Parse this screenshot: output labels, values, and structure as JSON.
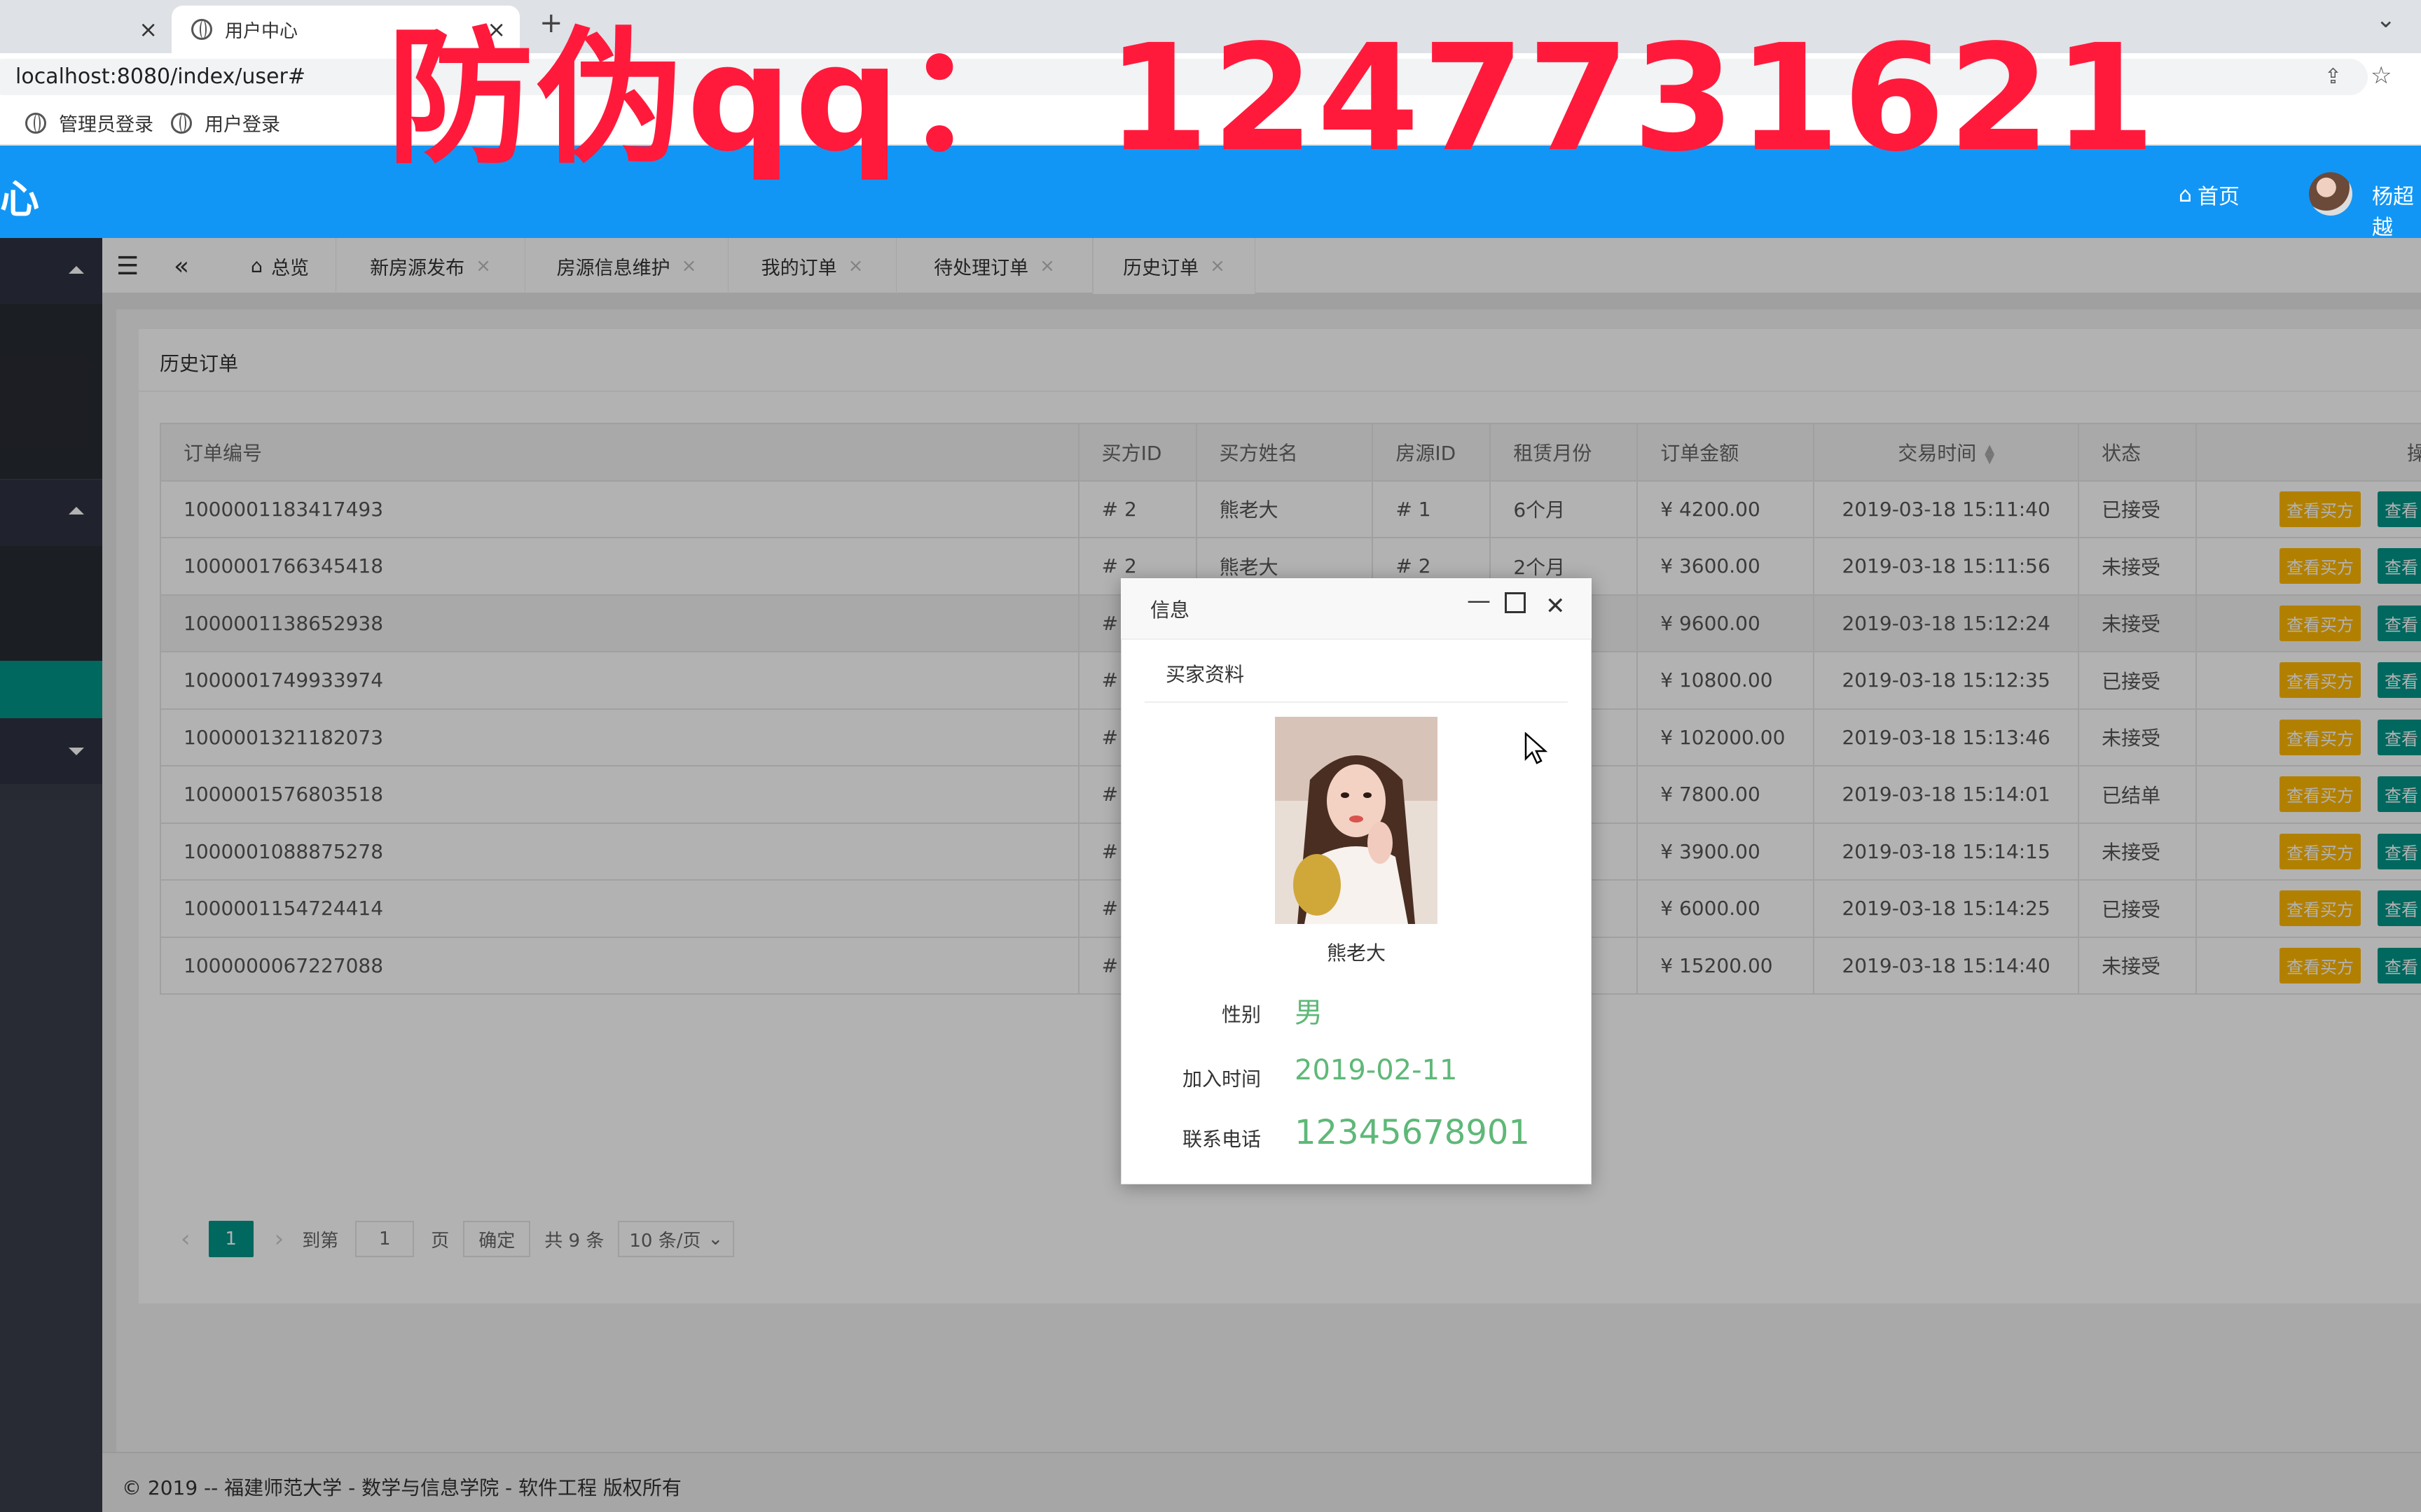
{
  "browser": {
    "tabs": [
      {
        "label": ""
      },
      {
        "label": "用户中心"
      }
    ],
    "url": "localhost:8080/index/user#",
    "bookmarks": [
      "管理员登录",
      "用户登录"
    ]
  },
  "watermark": "防伪qq： 1247731621",
  "header": {
    "logo_fragment": "心",
    "home_label": "首页",
    "user_name": "杨超越"
  },
  "tabs": [
    {
      "label": "总览"
    },
    {
      "label": "新房源发布"
    },
    {
      "label": "房源信息维护"
    },
    {
      "label": "我的订单"
    },
    {
      "label": "待处理订单"
    },
    {
      "label": "历史订单"
    }
  ],
  "panel": {
    "title": "历史订单"
  },
  "table": {
    "columns": [
      "订单编号",
      "买方ID",
      "买方姓名",
      "房源ID",
      "租赁月份",
      "订单金额",
      "交易时间",
      "状态",
      "操作"
    ],
    "rows": [
      {
        "order_no": "1000001183417493",
        "buyer_id": "# 2",
        "buyer_name": "熊老大",
        "house_id": "# 1",
        "months": "6个月",
        "amount": "¥ 4200.00",
        "time": "2019-03-18 15:11:40",
        "status": "已接受"
      },
      {
        "order_no": "1000001766345418",
        "buyer_id": "# 2",
        "buyer_name": "熊老大",
        "house_id": "# 2",
        "months": "2个月",
        "amount": "¥ 3600.00",
        "time": "2019-03-18 15:11:56",
        "status": "未接受"
      },
      {
        "order_no": "1000001138652938",
        "buyer_id": "#",
        "buyer_name": "",
        "house_id": "",
        "months": "",
        "amount": "¥ 9600.00",
        "time": "2019-03-18 15:12:24",
        "status": "未接受"
      },
      {
        "order_no": "1000001749933974",
        "buyer_id": "#",
        "buyer_name": "",
        "house_id": "",
        "months": "",
        "amount": "¥ 10800.00",
        "time": "2019-03-18 15:12:35",
        "status": "已接受"
      },
      {
        "order_no": "1000001321182073",
        "buyer_id": "#",
        "buyer_name": "",
        "house_id": "",
        "months": "",
        "amount": "¥ 102000.00",
        "time": "2019-03-18 15:13:46",
        "status": "未接受"
      },
      {
        "order_no": "1000001576803518",
        "buyer_id": "#",
        "buyer_name": "",
        "house_id": "",
        "months": "",
        "amount": "¥ 7800.00",
        "time": "2019-03-18 15:14:01",
        "status": "已结单"
      },
      {
        "order_no": "1000001088875278",
        "buyer_id": "#",
        "buyer_name": "",
        "house_id": "",
        "months": "",
        "amount": "¥ 3900.00",
        "time": "2019-03-18 15:14:15",
        "status": "未接受"
      },
      {
        "order_no": "1000001154724414",
        "buyer_id": "#",
        "buyer_name": "",
        "house_id": "",
        "months": "",
        "amount": "¥ 6000.00",
        "time": "2019-03-18 15:14:25",
        "status": "已接受"
      },
      {
        "order_no": "1000000067227088",
        "buyer_id": "#",
        "buyer_name": "",
        "house_id": "",
        "months": "",
        "amount": "¥ 15200.00",
        "time": "2019-03-18 15:14:40",
        "status": "未接受"
      }
    ],
    "action_buyer": "查看买方",
    "action_other": "查看"
  },
  "pager": {
    "current": "1",
    "goto_label": "到第",
    "goto_value": "1",
    "page_unit": "页",
    "confirm": "确定",
    "total": "共 9 条",
    "per_page": "10 条/页"
  },
  "footer": "© 2019 -- 福建师范大学 - 数学与信息学院 - 软件工程 版权所有",
  "dialog": {
    "title": "信息",
    "section": "买家资料",
    "buyer_name": "熊老大",
    "gender_label": "性别",
    "gender_value": "男",
    "join_label": "加入时间",
    "join_value": "2019-02-11",
    "phone_label": "联系电话",
    "phone_value": "12345678901"
  },
  "colors": {
    "header_blue": "#1296f5",
    "teal": "#009688",
    "amber": "#ffb800",
    "green_text": "#5fb878",
    "watermark_red": "#ff1a3c"
  }
}
